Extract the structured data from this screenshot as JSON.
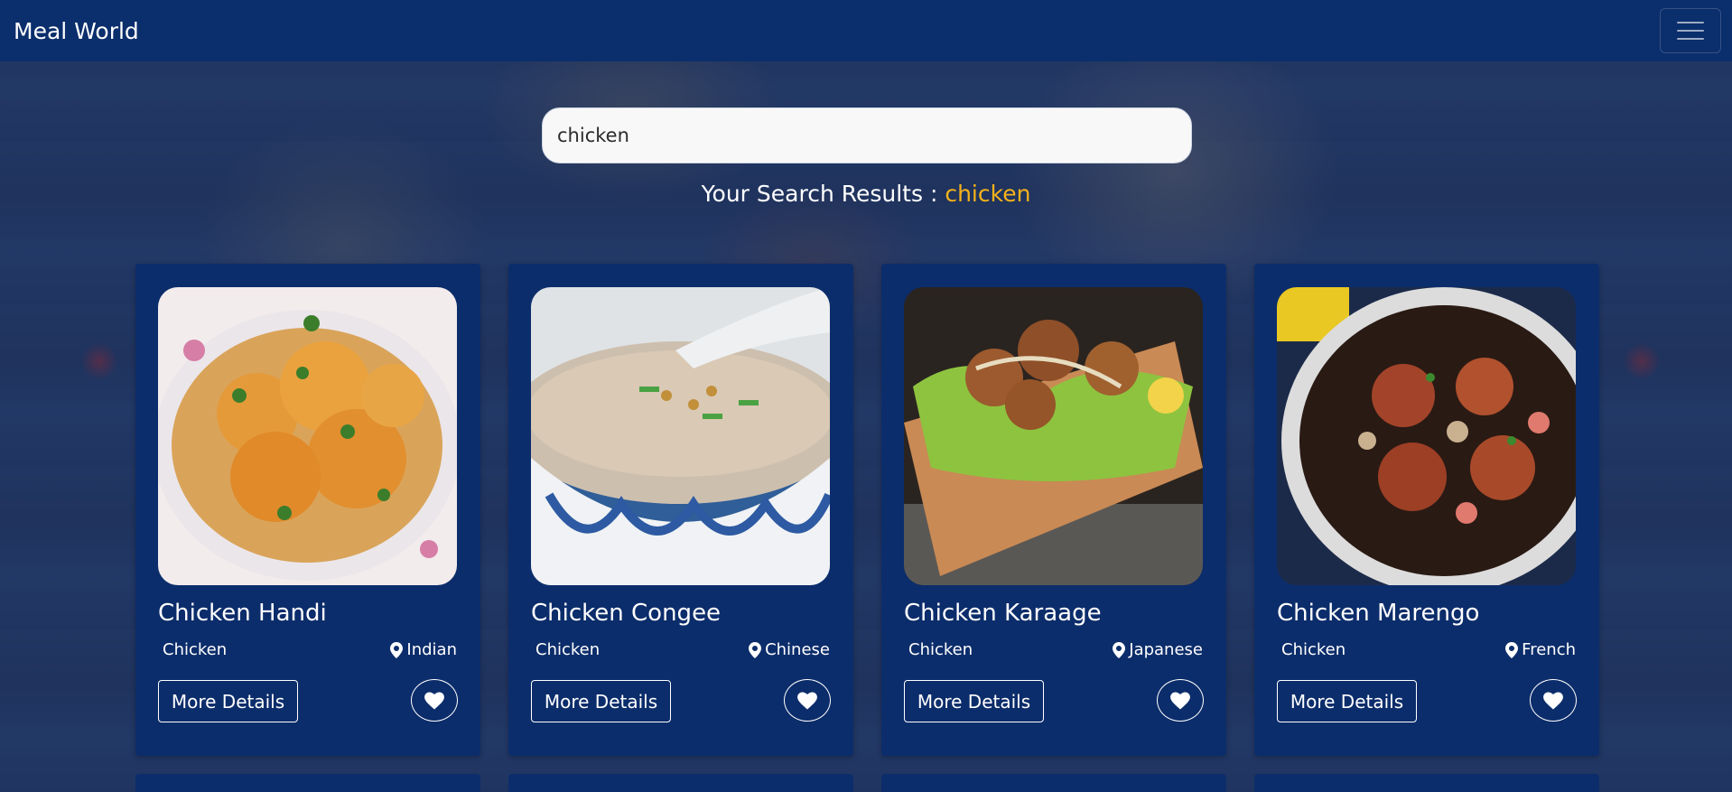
{
  "navbar": {
    "brand": "Meal World",
    "menu_icon": "hamburger-menu-icon"
  },
  "search": {
    "value": "chicken",
    "placeholder": ""
  },
  "results": {
    "label": "Your Search Results :",
    "query": "chicken"
  },
  "meals": [
    {
      "title": "Chicken Handi",
      "category": "Chicken",
      "area": "Indian",
      "details_label": "More Details",
      "fav_icon": "heart-icon"
    },
    {
      "title": "Chicken Congee",
      "category": "Chicken",
      "area": "Chinese",
      "details_label": "More Details",
      "fav_icon": "heart-icon"
    },
    {
      "title": "Chicken Karaage",
      "category": "Chicken",
      "area": "Japanese",
      "details_label": "More Details",
      "fav_icon": "heart-icon"
    },
    {
      "title": "Chicken Marengo",
      "category": "Chicken",
      "area": "French",
      "details_label": "More Details",
      "fav_icon": "heart-icon"
    }
  ],
  "colors": {
    "navbar_bg": "#0b2e6c",
    "card_bg": "#0c2d6b",
    "accent": "#f5b21b"
  }
}
